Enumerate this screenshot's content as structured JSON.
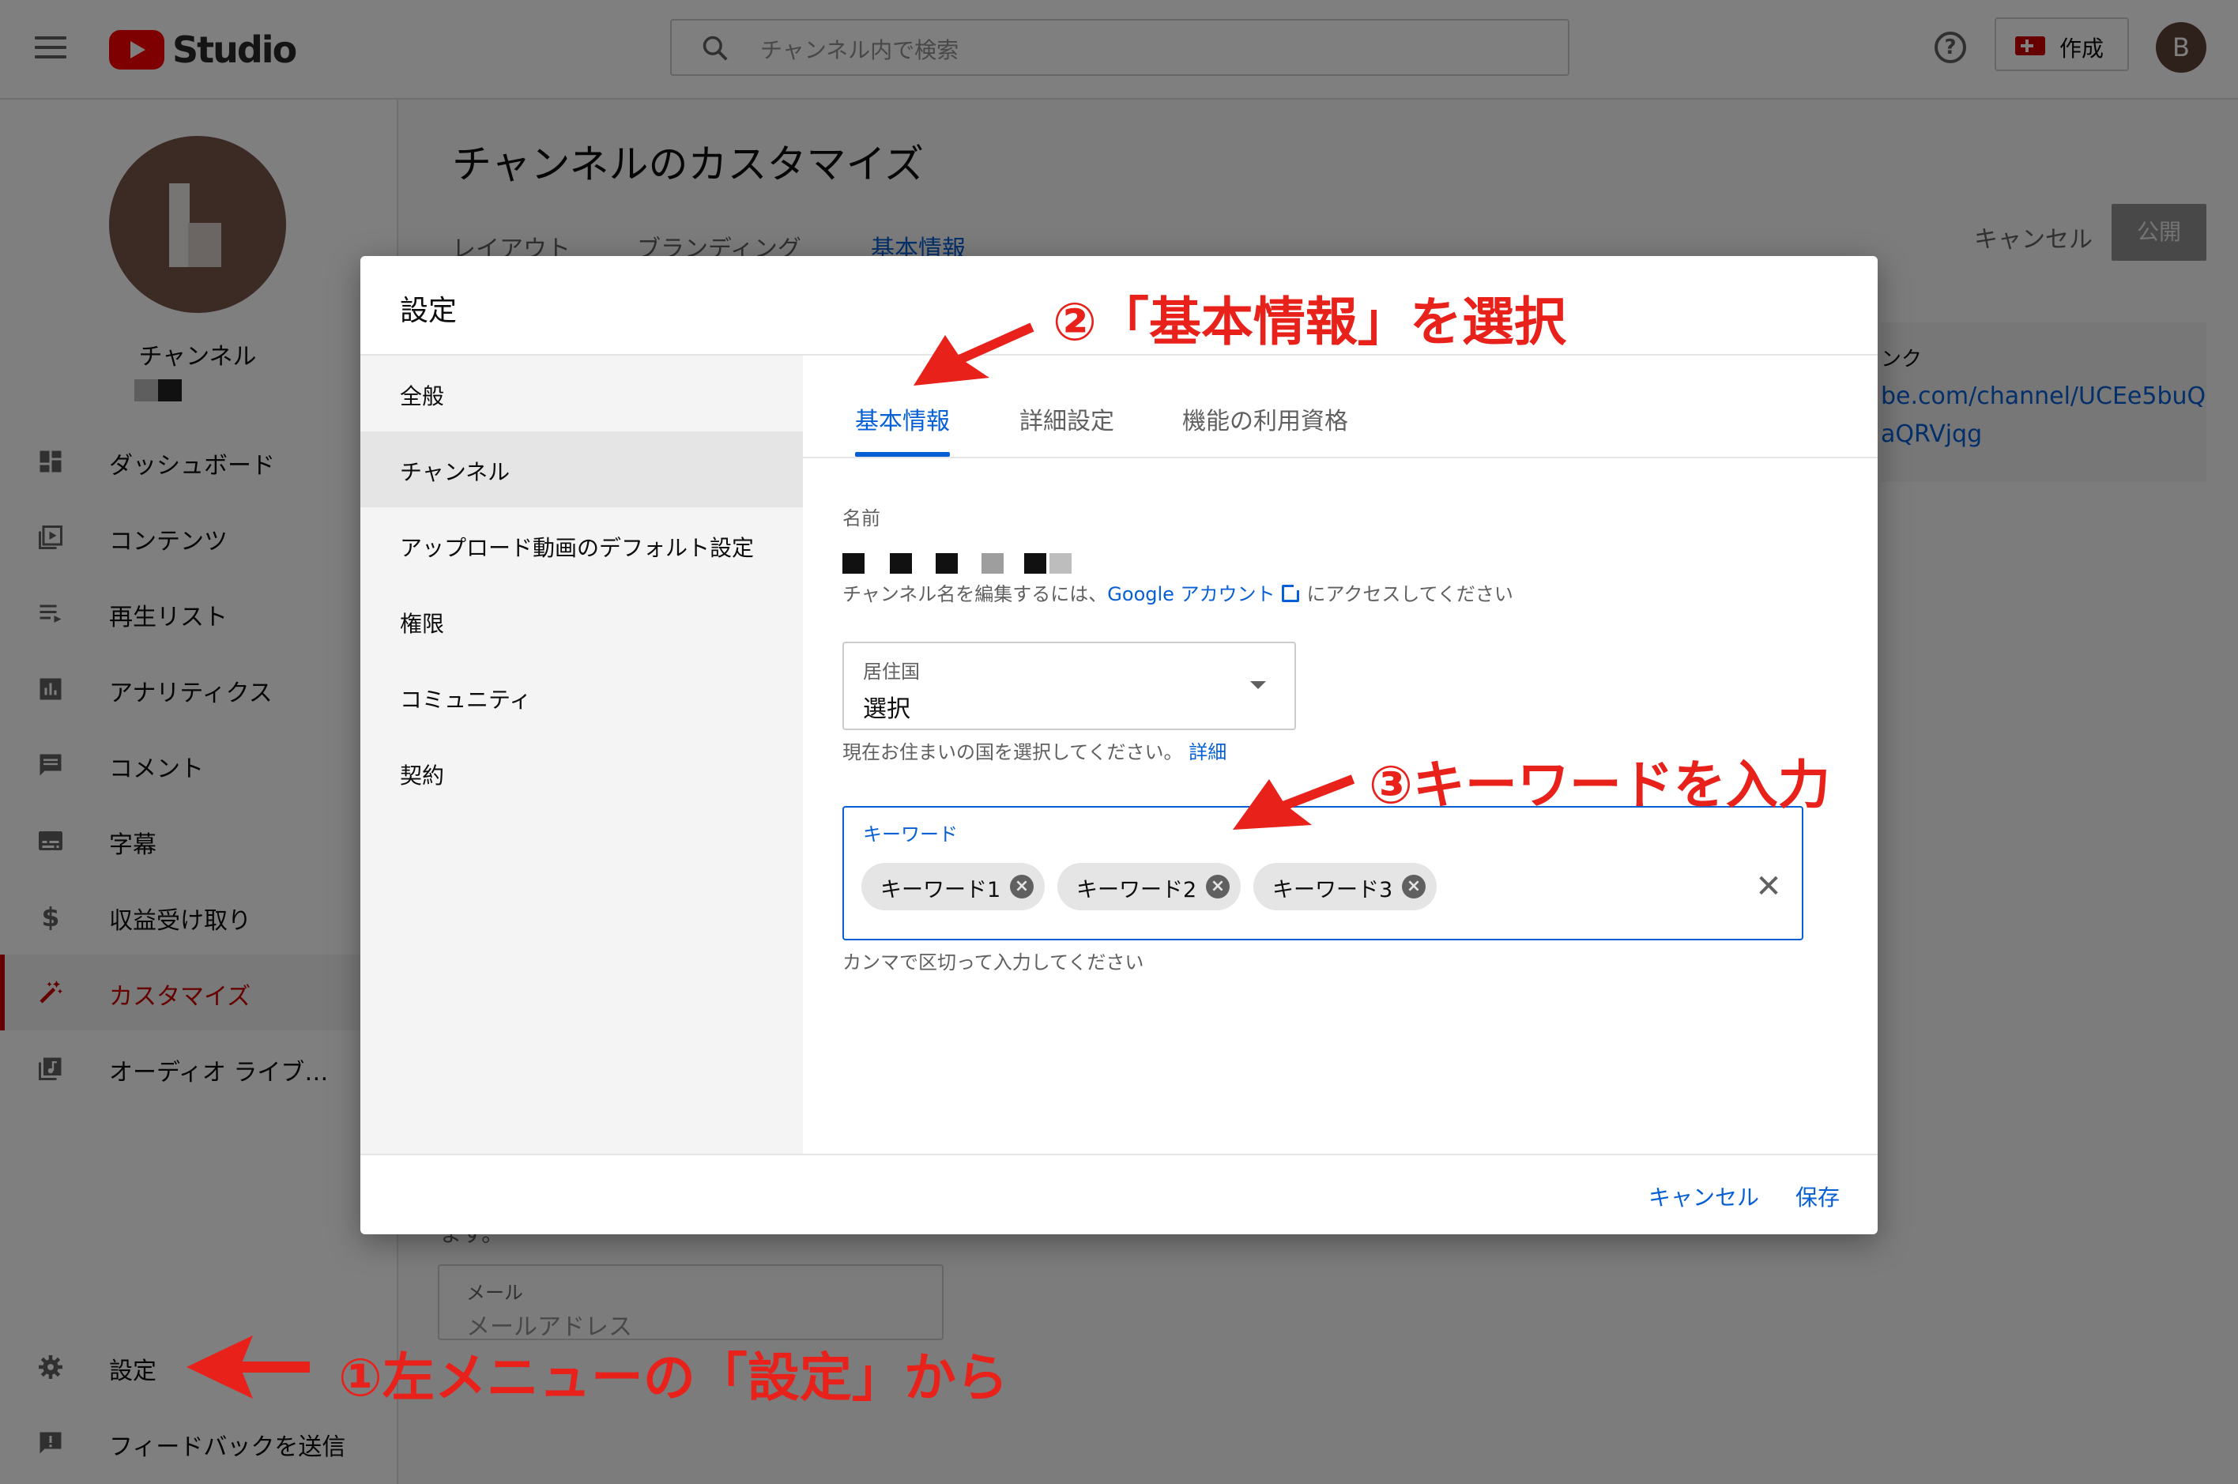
{
  "header": {
    "logo_text": "Studio",
    "search_placeholder": "チャンネル内で検索",
    "create_label": "作成",
    "avatar_letter": "B"
  },
  "sidebar": {
    "channel_name": "チャンネル",
    "items": [
      {
        "label": "ダッシュボード",
        "icon": "dashboard-icon"
      },
      {
        "label": "コンテンツ",
        "icon": "content-icon"
      },
      {
        "label": "再生リスト",
        "icon": "playlist-icon"
      },
      {
        "label": "アナリティクス",
        "icon": "analytics-icon"
      },
      {
        "label": "コメント",
        "icon": "comment-icon"
      },
      {
        "label": "字幕",
        "icon": "subtitles-icon"
      },
      {
        "label": "収益受け取り",
        "icon": "dollar-icon"
      },
      {
        "label": "カスタマイズ",
        "icon": "magic-wand-icon",
        "active": true
      },
      {
        "label": "オーディオ ライブ…",
        "icon": "audio-library-icon"
      }
    ],
    "settings_label": "設定",
    "feedback_label": "フィードバックを送信"
  },
  "page": {
    "title": "チャンネルのカスタマイズ",
    "tabs": [
      "レイアウト",
      "ブランディング",
      "基本情報"
    ],
    "active_tab": "基本情報",
    "cancel_label": "キャンセル",
    "publish_label": "公開",
    "link_card_title": "ンク",
    "link_card_url_line1": "be.com/channel/UCEe5buQ",
    "link_card_url_line2": "aQRVjqg",
    "email_note": "ます。",
    "email_label": "メール",
    "email_placeholder": "メールアドレス"
  },
  "dialog": {
    "title": "設定",
    "nav": [
      "全般",
      "チャンネル",
      "アップロード動画のデフォルト設定",
      "権限",
      "コミュニティ",
      "契約"
    ],
    "nav_active": "チャンネル",
    "tabs": [
      "基本情報",
      "詳細設定",
      "機能の利用資格"
    ],
    "active_tab": "基本情報",
    "name_label": "名前",
    "name_help_prefix": "チャンネル名を編集するには、",
    "name_help_link": "Google アカウント",
    "name_help_suffix": "にアクセスしてください",
    "country_label": "居住国",
    "country_value": "選択",
    "country_help": "現在お住まいの国を選択してください。",
    "country_help_link": "詳細",
    "keywords_label": "キーワード",
    "keywords": [
      "キーワード1",
      "キーワード2",
      "キーワード3"
    ],
    "keywords_help": "カンマで区切って入力してください",
    "cancel_label": "キャンセル",
    "save_label": "保存"
  },
  "annotations": {
    "step1": "①左メニューの「設定」から",
    "step2": "②「基本情報」を選択",
    "step3": "③キーワードを入力",
    "accent_color": "#e8211b"
  },
  "colors": {
    "brand_red": "#ff0000",
    "active_red": "#cc0000",
    "link_blue": "#065fd4"
  }
}
